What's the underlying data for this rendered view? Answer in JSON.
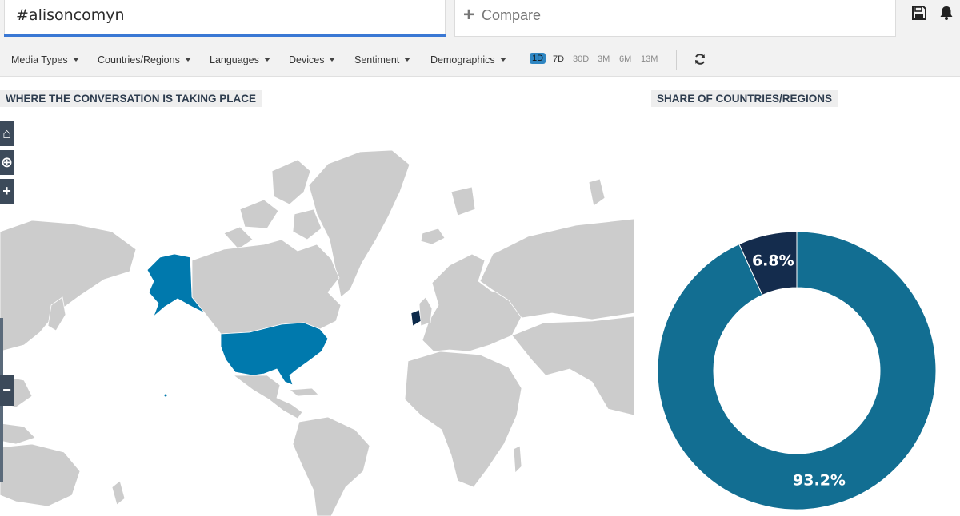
{
  "search": {
    "value": "#alisoncomyn"
  },
  "compare": {
    "label": "Compare"
  },
  "toolbar": {
    "save_icon": "save-icon",
    "notifications_icon": "bell-icon"
  },
  "filters": [
    {
      "label": "Media Types"
    },
    {
      "label": "Countries/Regions"
    },
    {
      "label": "Languages"
    },
    {
      "label": "Devices"
    },
    {
      "label": "Sentiment"
    },
    {
      "label": "Demographics"
    }
  ],
  "ranges": [
    {
      "label": "1D",
      "state": "active"
    },
    {
      "label": "7D",
      "state": "current"
    },
    {
      "label": "30D",
      "state": ""
    },
    {
      "label": "3M",
      "state": ""
    },
    {
      "label": "6M",
      "state": ""
    },
    {
      "label": "13M",
      "state": ""
    }
  ],
  "refresh_icon": "refresh-icon",
  "map": {
    "heading": "WHERE THE CONVERSATION IS TAKING PLACE",
    "controls": [
      "home-icon",
      "locate-icon",
      "zoom-in-icon",
      "zoom-out-icon"
    ],
    "highlighted_regions": [
      "United States",
      "Ireland"
    ],
    "colors": {
      "land": "#cccccc",
      "highlight": "#0079ad",
      "secondary": "#0d2a4a"
    }
  },
  "share": {
    "heading": "SHARE OF COUNTRIES/REGIONS"
  },
  "chart_data": {
    "type": "pie",
    "donut": true,
    "slices": [
      {
        "value": 93.2,
        "label": "93.2%",
        "color": "#126e92"
      },
      {
        "value": 6.8,
        "label": "6.8%",
        "color": "#142c4d"
      }
    ]
  }
}
